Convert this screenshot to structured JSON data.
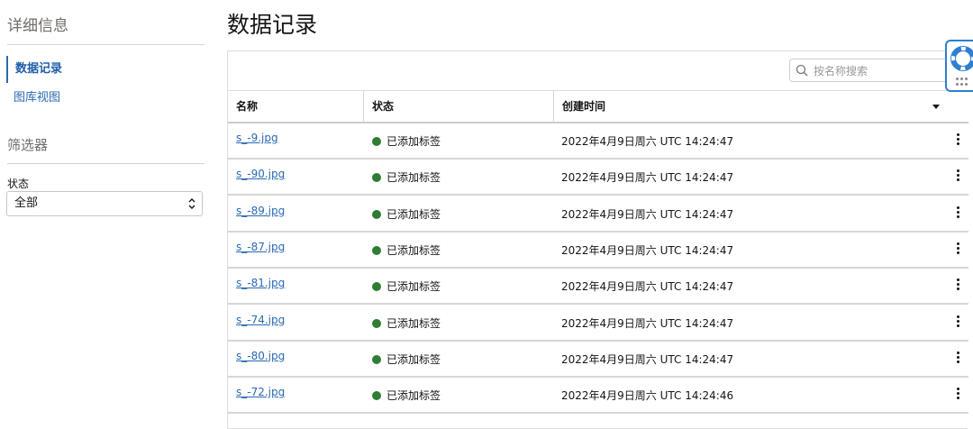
{
  "sidebar": {
    "title": "详细信息",
    "nav": [
      {
        "label": "数据记录",
        "active": true
      },
      {
        "label": "图库视图",
        "active": false
      }
    ],
    "filter_title": "筛选器",
    "status_filter": {
      "label": "状态",
      "value": "全部"
    }
  },
  "main": {
    "title": "数据记录",
    "search_placeholder": "按名称搜索",
    "columns": [
      "名称",
      "状态",
      "创建时间"
    ],
    "rows": [
      {
        "name": "s_-9.jpg",
        "status": "已添加标签",
        "created": "2022年4月9日周六 UTC 14:24:47"
      },
      {
        "name": "s_-90.jpg",
        "status": "已添加标签",
        "created": "2022年4月9日周六 UTC 14:24:47"
      },
      {
        "name": "s_-89.jpg",
        "status": "已添加标签",
        "created": "2022年4月9日周六 UTC 14:24:47"
      },
      {
        "name": "s_-87.jpg",
        "status": "已添加标签",
        "created": "2022年4月9日周六 UTC 14:24:47"
      },
      {
        "name": "s_-81.jpg",
        "status": "已添加标签",
        "created": "2022年4月9日周六 UTC 14:24:47"
      },
      {
        "name": "s_-74.jpg",
        "status": "已添加标签",
        "created": "2022年4月9日周六 UTC 14:24:47"
      },
      {
        "name": "s_-80.jpg",
        "status": "已添加标签",
        "created": "2022年4月9日周六 UTC 14:24:47"
      },
      {
        "name": "s_-72.jpg",
        "status": "已添加标签",
        "created": "2022年4月9日周六 UTC 14:24:46"
      }
    ]
  },
  "colors": {
    "link": "#2a6ab3",
    "status_ok": "#2f7d32",
    "accent": "#2f7ed1"
  },
  "icons": [
    "search-icon",
    "select-chevron-icon",
    "sort-caret-icon",
    "status-dot-icon",
    "kebab-menu-icon",
    "lifebuoy-help-icon",
    "grip-icon"
  ]
}
